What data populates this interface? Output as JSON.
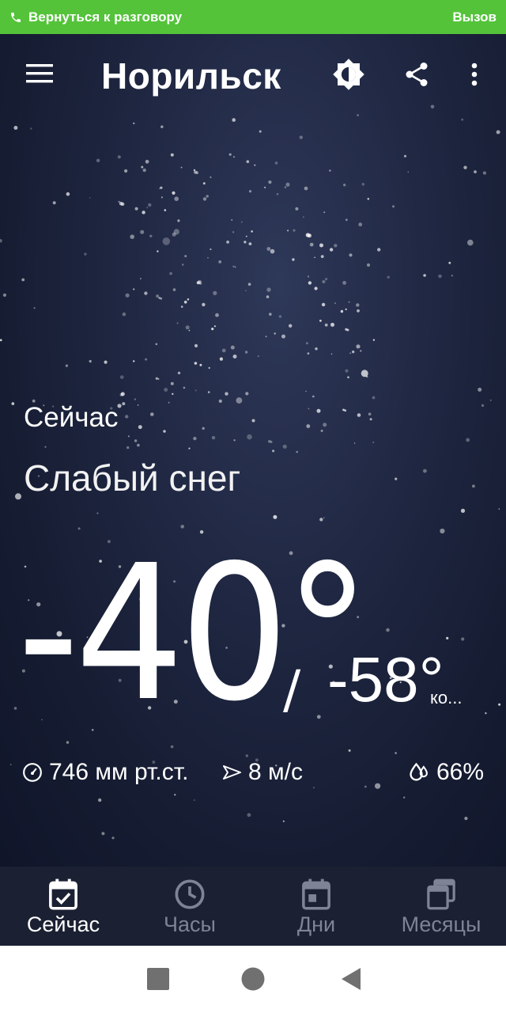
{
  "call_bar": {
    "return_label": "Вернуться к разговору",
    "action_label": "Вызов"
  },
  "toolbar": {
    "city": "Норильск",
    "icons": [
      "menu-icon",
      "brightness-icon",
      "share-icon",
      "more-vert-icon"
    ]
  },
  "weather": {
    "section_title": "Сейчас",
    "condition": "Слабый снег",
    "temperature": "-40°",
    "separator": "/",
    "feels_like": "-58°",
    "feels_label": "ко...",
    "pressure": "746 мм рт.ст.",
    "wind": "8 м/с",
    "humidity": "66%"
  },
  "bottom_nav": {
    "items": [
      {
        "label": "Сейчас",
        "icon": "calendar-check-icon",
        "active": true
      },
      {
        "label": "Часы",
        "icon": "clock-icon",
        "active": false
      },
      {
        "label": "Дни",
        "icon": "calendar-day-icon",
        "active": false
      },
      {
        "label": "Месяцы",
        "icon": "calendar-stack-icon",
        "active": false
      }
    ]
  },
  "colors": {
    "call_bar": "#54c33a",
    "background": "#1a2238",
    "nav_background": "#1b2133",
    "nav_inactive": "#7e8496"
  }
}
